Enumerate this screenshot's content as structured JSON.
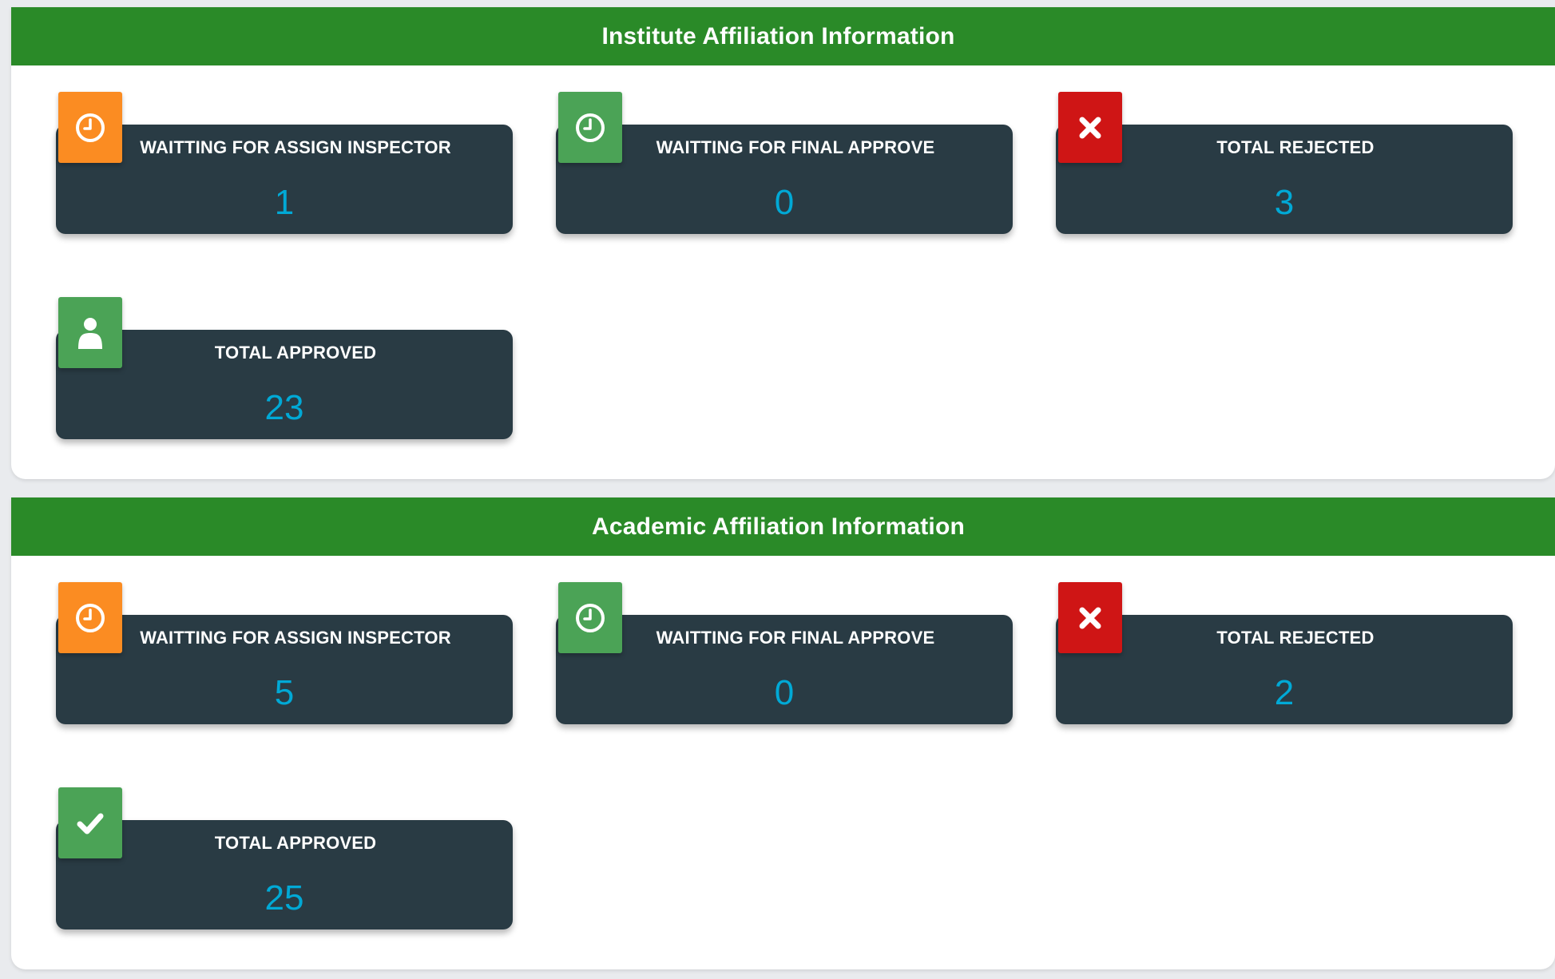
{
  "colors": {
    "header": "#2a8a28",
    "card": "#293b44",
    "value": "#00a9d6",
    "orange": "#fb8c22",
    "green": "#4ba356",
    "red": "#cf1515"
  },
  "institute": {
    "title": "Institute Affiliation Information",
    "cards": [
      {
        "label": "WAITTING FOR ASSIGN INSPECTOR",
        "value": "1",
        "icon": "clock-icon",
        "color": "orange"
      },
      {
        "label": "WAITTING FOR FINAL APPROVE",
        "value": "0",
        "icon": "clock-icon",
        "color": "green"
      },
      {
        "label": "TOTAL REJECTED",
        "value": "3",
        "icon": "close-icon",
        "color": "red"
      },
      {
        "label": "TOTAL APPROVED",
        "value": "23",
        "icon": "user-icon",
        "color": "green"
      }
    ]
  },
  "academic": {
    "title": "Academic Affiliation Information",
    "cards": [
      {
        "label": "WAITTING FOR ASSIGN INSPECTOR",
        "value": "5",
        "icon": "clock-icon",
        "color": "orange"
      },
      {
        "label": "WAITTING FOR FINAL APPROVE",
        "value": "0",
        "icon": "clock-icon",
        "color": "green"
      },
      {
        "label": "TOTAL REJECTED",
        "value": "2",
        "icon": "close-icon",
        "color": "red"
      },
      {
        "label": "TOTAL APPROVED",
        "value": "25",
        "icon": "check-icon",
        "color": "green"
      }
    ]
  }
}
